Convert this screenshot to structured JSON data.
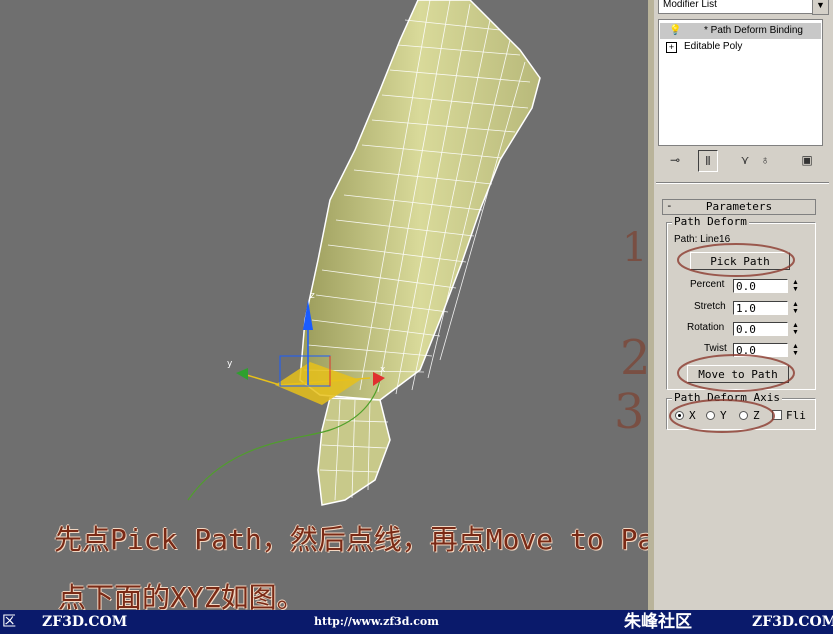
{
  "viewport": {
    "caption_line1": "先点Pick Path，然后点线，再点Move to Path，",
    "caption_line2": "点下面的XYZ如图。",
    "axis_labels": {
      "x": "x",
      "y": "y",
      "z": "z"
    },
    "colors": {
      "background": "#6f6f6f",
      "mesh_fill": "#cfd08c",
      "mesh_lines": "#ffffff",
      "path_spline": "#4fa02a",
      "caption": "#7a2a16"
    }
  },
  "modifier_panel": {
    "modifier_list_label": "Modifier List",
    "stack_items": [
      {
        "label": "* Path Deform Binding",
        "selected": true
      },
      {
        "label": "Editable Poly",
        "selected": false
      }
    ],
    "toolbar_icons": [
      "pin-stack-icon",
      "show-end-result-icon",
      "make-unique-icon",
      "remove-modifier-icon",
      "configure-sets-icon"
    ]
  },
  "parameters": {
    "rollout_title": "Parameters",
    "path_deform_group": "Path Deform",
    "path_label": "Path: Line16",
    "pick_path_button": "Pick Path",
    "percent_label": "Percent",
    "percent_value": "0.0",
    "stretch_label": "Stretch",
    "stretch_value": "1.0",
    "rotation_label": "Rotation",
    "rotation_value": "0.0",
    "twist_label": "Twist",
    "twist_value": "0.0",
    "move_to_path_button": "Move to Path",
    "axis_group": "Path Deform Axis",
    "axis_options": [
      "X",
      "Y",
      "Z"
    ],
    "axis_selected": "X",
    "flip_label": "Fli"
  },
  "annotations": {
    "one": "1",
    "two": "2",
    "three": "3"
  },
  "bottom_bar": {
    "left_fragment": "区",
    "site_left": "ZF3D.COM",
    "url": "http://www.zf3d.com",
    "brand": "朱峰社区",
    "site_right": "ZF3D.COM"
  }
}
